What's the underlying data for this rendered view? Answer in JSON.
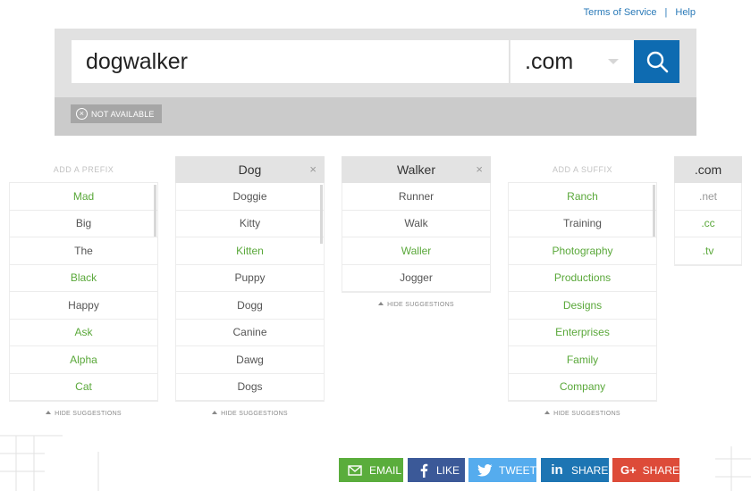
{
  "top_links": {
    "terms": "Terms of Service",
    "separator": "|",
    "help": "Help"
  },
  "search": {
    "value": "dogwalker",
    "tld": ".com",
    "status": "NOT AVAILABLE"
  },
  "columns": [
    {
      "header": "ADD A PREFIX",
      "header_style": "placeholder",
      "items": [
        {
          "label": "Mad",
          "color": "green"
        },
        {
          "label": "Big",
          "color": "normal"
        },
        {
          "label": "The",
          "color": "normal"
        },
        {
          "label": "Black",
          "color": "green"
        },
        {
          "label": "Happy",
          "color": "normal"
        },
        {
          "label": "Ask",
          "color": "green"
        },
        {
          "label": "Alpha",
          "color": "green"
        },
        {
          "label": "Cat",
          "color": "green"
        }
      ],
      "hide": "HIDE SUGGESTIONS"
    },
    {
      "header": "Dog",
      "header_style": "filled",
      "items": [
        {
          "label": "Doggie",
          "color": "normal"
        },
        {
          "label": "Kitty",
          "color": "normal"
        },
        {
          "label": "Kitten",
          "color": "green"
        },
        {
          "label": "Puppy",
          "color": "normal"
        },
        {
          "label": "Dogg",
          "color": "normal"
        },
        {
          "label": "Canine",
          "color": "normal"
        },
        {
          "label": "Dawg",
          "color": "normal"
        },
        {
          "label": "Dogs",
          "color": "normal"
        }
      ],
      "hide": "HIDE SUGGESTIONS"
    },
    {
      "header": "Walker",
      "header_style": "filled",
      "items": [
        {
          "label": "Runner",
          "color": "normal"
        },
        {
          "label": "Walk",
          "color": "normal"
        },
        {
          "label": "Waller",
          "color": "green"
        },
        {
          "label": "Jogger",
          "color": "normal"
        }
      ],
      "hide": "HIDE SUGGESTIONS"
    },
    {
      "header": "ADD A SUFFIX",
      "header_style": "placeholder",
      "items": [
        {
          "label": "Ranch",
          "color": "green"
        },
        {
          "label": "Training",
          "color": "normal"
        },
        {
          "label": "Photography",
          "color": "green"
        },
        {
          "label": "Productions",
          "color": "green"
        },
        {
          "label": "Designs",
          "color": "green"
        },
        {
          "label": "Enterprises",
          "color": "green"
        },
        {
          "label": "Family",
          "color": "green"
        },
        {
          "label": "Company",
          "color": "green"
        }
      ],
      "hide": "HIDE SUGGESTIONS"
    },
    {
      "header": ".com",
      "header_style": "filled",
      "items": [
        {
          "label": ".net",
          "color": "grey"
        },
        {
          "label": ".cc",
          "color": "green"
        },
        {
          "label": ".tv",
          "color": "green"
        }
      ]
    }
  ],
  "share": [
    {
      "label": "EMAIL",
      "icon": "email-icon",
      "color": "#5aad3c"
    },
    {
      "label": "LIKE",
      "icon": "facebook-icon",
      "color": "#3b5998"
    },
    {
      "label": "TWEET",
      "icon": "twitter-icon",
      "color": "#55acee"
    },
    {
      "label": "SHARE",
      "icon": "linkedin-icon",
      "color": "#1d75b3"
    },
    {
      "label": "SHARE",
      "icon": "google-plus-icon",
      "color": "#dd4b39"
    }
  ],
  "colors": {
    "accent": "#0e6bb1",
    "available_green": "#5aa83a",
    "panel": "#e1e1e1"
  }
}
